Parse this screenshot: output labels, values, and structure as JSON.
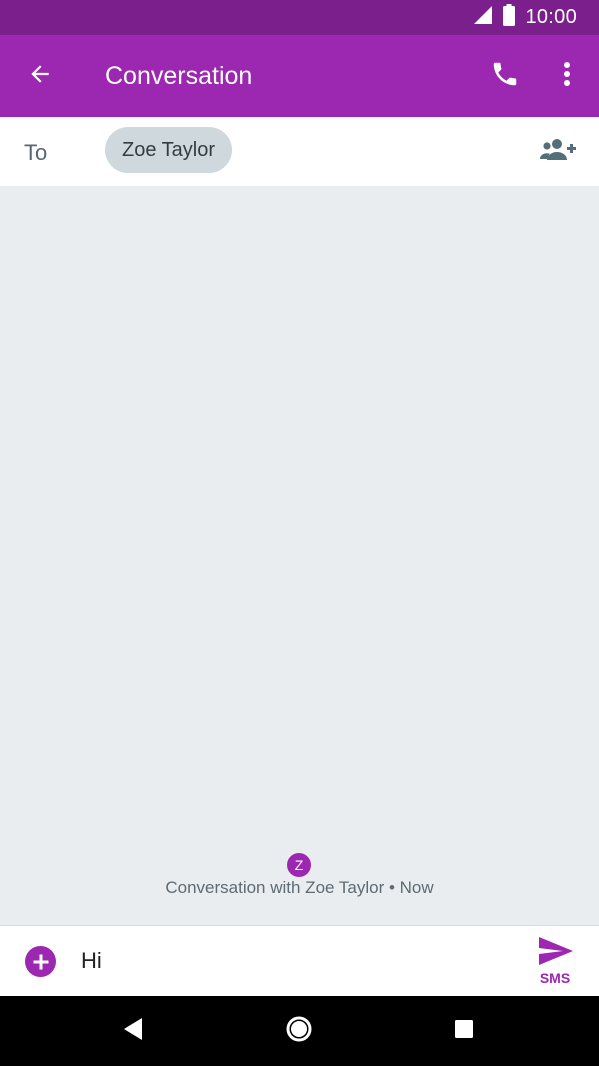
{
  "status_bar": {
    "time": "10:00",
    "icons": [
      "cell-signal-icon",
      "battery-icon"
    ]
  },
  "app_bar": {
    "title": "Conversation",
    "back_icon": "arrow-back-icon",
    "call_icon": "phone-icon",
    "more_icon": "more-vert-icon"
  },
  "recipients": {
    "to_label": "To",
    "chips": [
      "Zoe Taylor"
    ],
    "add_icon": "add-person-icon"
  },
  "conversation": {
    "avatar_letter": "Z",
    "info": "Conversation with Zoe Taylor • Now"
  },
  "compose": {
    "attach_icon": "add-circle-icon",
    "value": "Hi",
    "send_label": "SMS",
    "send_icon": "send-icon"
  },
  "nav_bar": {
    "icons": [
      "nav-back-icon",
      "nav-home-icon",
      "nav-recents-icon"
    ]
  },
  "colors": {
    "status_bar": "#7b1f8c",
    "app_bar": "#9c27b0",
    "accent": "#9c27b0",
    "background": "#e9edf0",
    "chip": "#cfd8dc"
  }
}
